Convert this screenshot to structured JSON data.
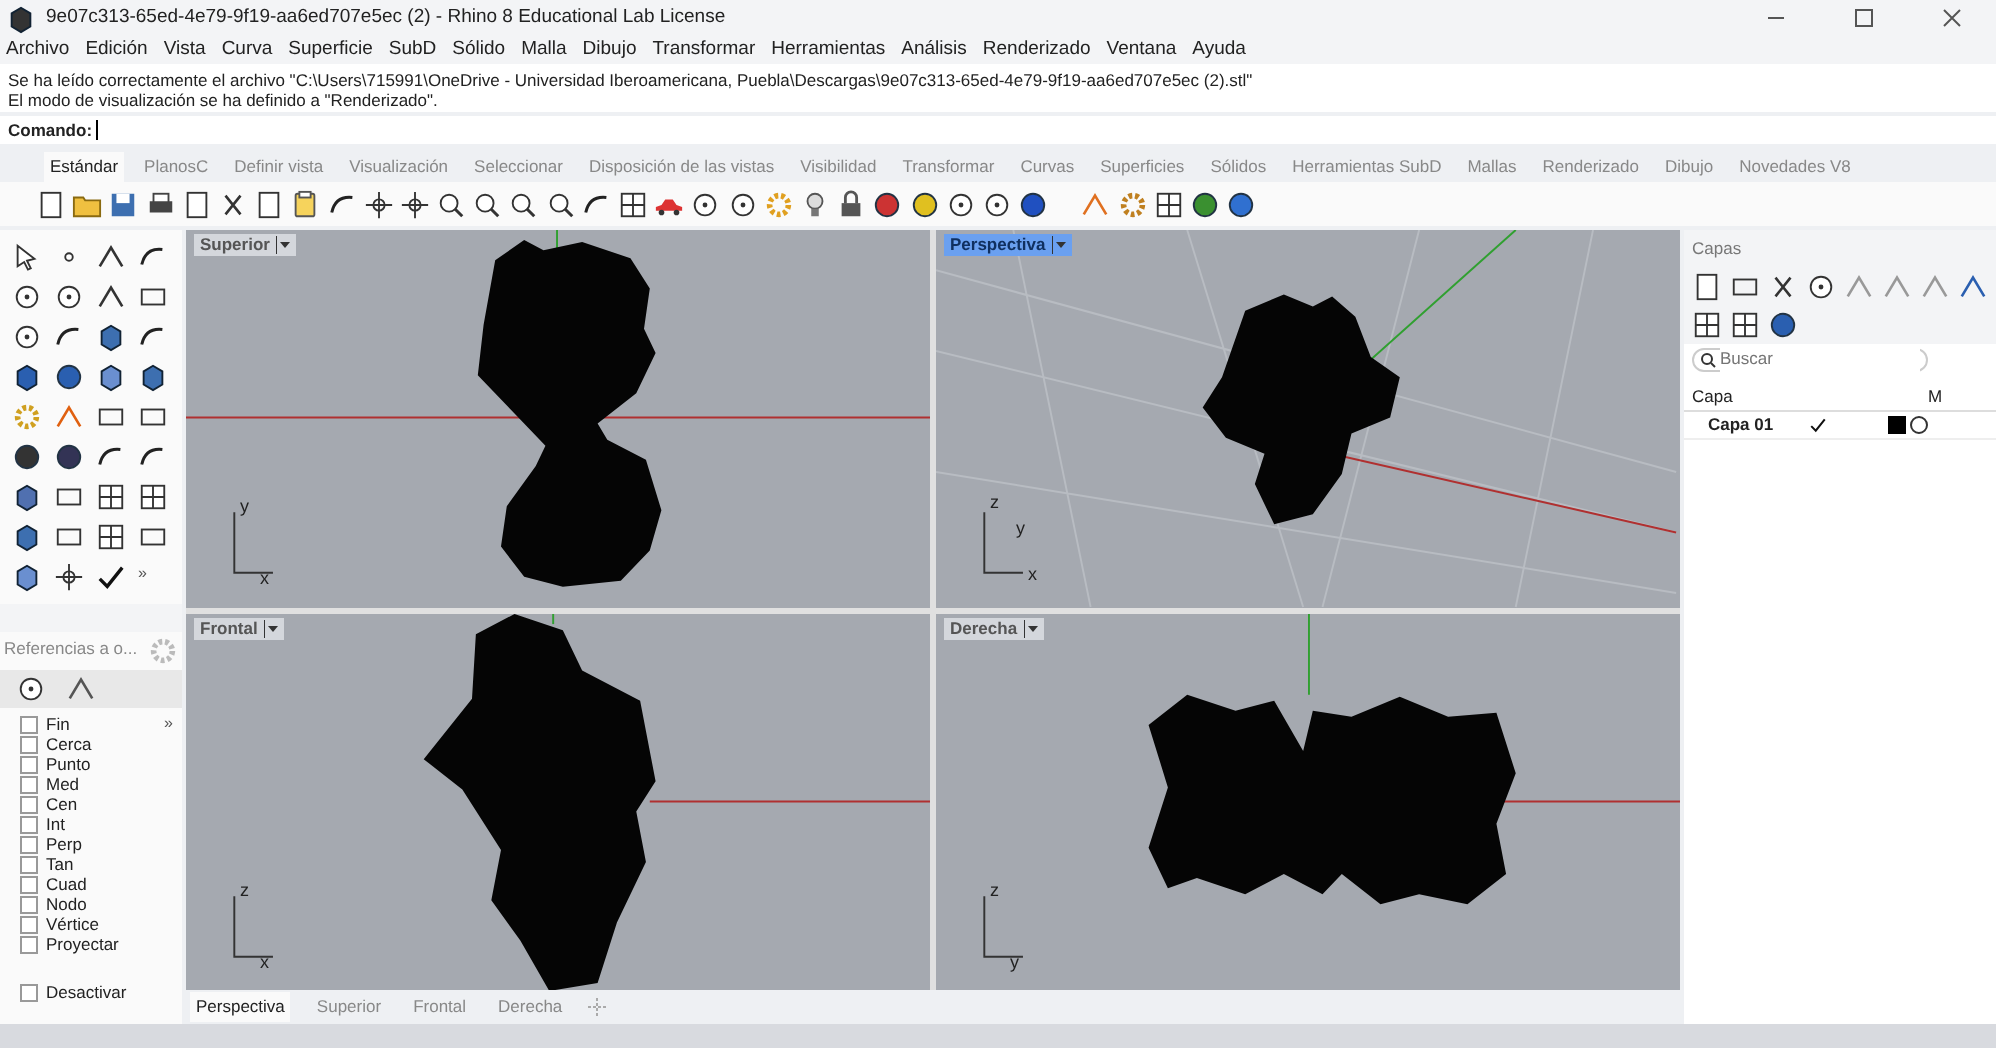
{
  "window": {
    "title": "9e07c313-65ed-4e79-9f19-aa6ed707e5ec (2) - Rhino 8 Educational Lab License"
  },
  "menu": [
    "Archivo",
    "Edición",
    "Vista",
    "Curva",
    "Superficie",
    "SubD",
    "Sólido",
    "Malla",
    "Dibujo",
    "Transformar",
    "Herramientas",
    "Análisis",
    "Renderizado",
    "Ventana",
    "Ayuda"
  ],
  "command_history": [
    "Se ha leído correctamente el archivo \"C:\\Users\\715991\\OneDrive - Universidad Iberoamericana, Puebla\\Descargas\\9e07c313-65ed-4e79-9f19-aa6ed707e5ec (2).stl\"",
    "El modo de visualización se ha definido a \"Renderizado\"."
  ],
  "command_prompt": {
    "label": "Comando:"
  },
  "toolbar_tabs": [
    {
      "label": "Estándar",
      "selected": true
    },
    {
      "label": "PlanosC",
      "selected": false
    },
    {
      "label": "Definir vista",
      "selected": false
    },
    {
      "label": "Visualización",
      "selected": false
    },
    {
      "label": "Seleccionar",
      "selected": false
    },
    {
      "label": "Disposición de las vistas",
      "selected": false
    },
    {
      "label": "Visibilidad",
      "selected": false
    },
    {
      "label": "Transformar",
      "selected": false
    },
    {
      "label": "Curvas",
      "selected": false
    },
    {
      "label": "Superficies",
      "selected": false
    },
    {
      "label": "Sólidos",
      "selected": false
    },
    {
      "label": "Herramientas SubD",
      "selected": false
    },
    {
      "label": "Mallas",
      "selected": false
    },
    {
      "label": "Renderizado",
      "selected": false
    },
    {
      "label": "Dibujo",
      "selected": false
    },
    {
      "label": "Novedades V8",
      "selected": false
    }
  ],
  "left_toolbar": {
    "more": "»"
  },
  "osnap_panel": {
    "title": "Referencias a o...",
    "more": "»",
    "snaps": [
      {
        "label": "Fin",
        "checked": false
      },
      {
        "label": "Cerca",
        "checked": false
      },
      {
        "label": "Punto",
        "checked": false
      },
      {
        "label": "Med",
        "checked": false
      },
      {
        "label": "Cen",
        "checked": false
      },
      {
        "label": "Int",
        "checked": false
      },
      {
        "label": "Perp",
        "checked": false
      },
      {
        "label": "Tan",
        "checked": false
      },
      {
        "label": "Cuad",
        "checked": false
      },
      {
        "label": "Nodo",
        "checked": false
      },
      {
        "label": "Vértice",
        "checked": false
      },
      {
        "label": "Proyectar",
        "checked": false
      }
    ],
    "disable": {
      "label": "Desactivar",
      "checked": false
    }
  },
  "viewports": [
    {
      "label": "Superior",
      "active": false,
      "axes": [
        "y",
        "x"
      ]
    },
    {
      "label": "Perspectiva",
      "active": true,
      "axes": [
        "z",
        "y",
        "x"
      ]
    },
    {
      "label": "Frontal",
      "active": false,
      "axes": [
        "z",
        "x"
      ]
    },
    {
      "label": "Derecha",
      "active": false,
      "axes": [
        "z",
        "y"
      ]
    }
  ],
  "viewport_tabs": [
    {
      "label": "Perspectiva",
      "selected": true
    },
    {
      "label": "Superior",
      "selected": false
    },
    {
      "label": "Frontal",
      "selected": false
    },
    {
      "label": "Derecha",
      "selected": false
    }
  ],
  "layers_panel": {
    "title": "Capas",
    "search_placeholder": "Buscar",
    "columns": [
      "Capa",
      "M"
    ],
    "layers": [
      {
        "name": "Capa 01",
        "current": true,
        "color": "#000000"
      }
    ]
  }
}
